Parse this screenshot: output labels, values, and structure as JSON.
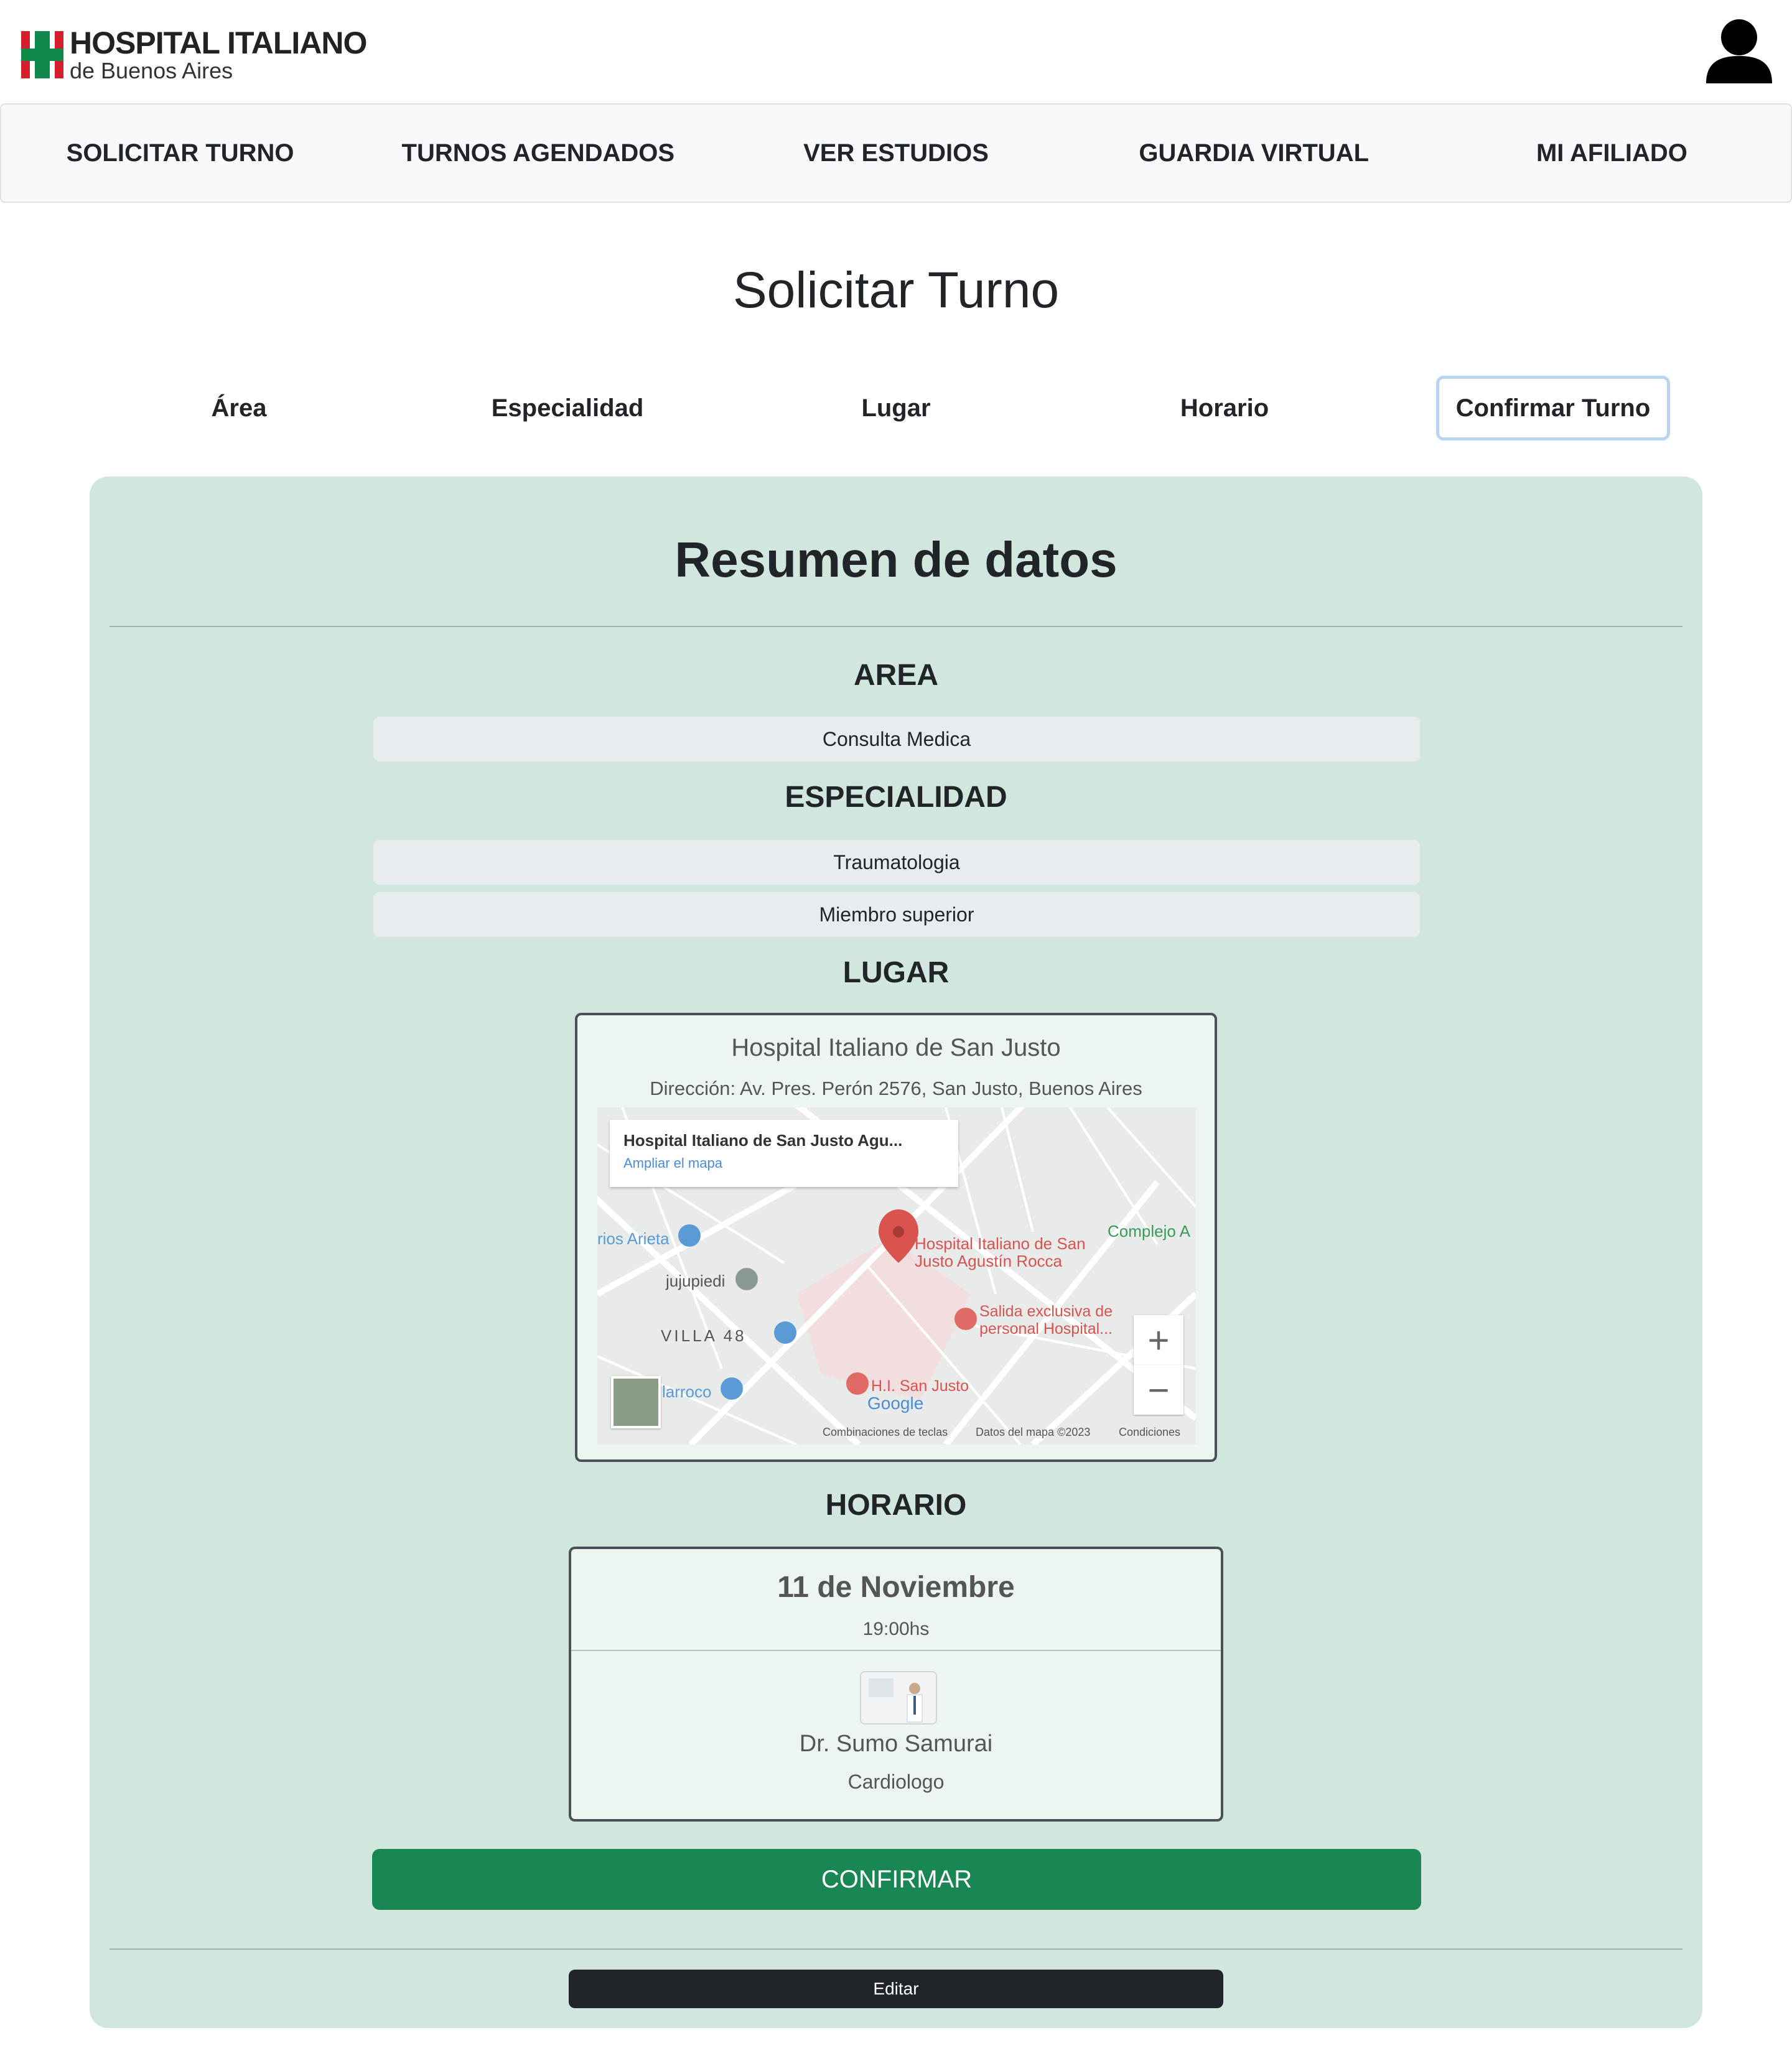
{
  "header": {
    "logo_line1": "HOSPITAL ITALIANO",
    "logo_line2": "de Buenos Aires",
    "user_icon": "user-icon"
  },
  "nav": {
    "items": [
      {
        "label": "SOLICITAR TURNO"
      },
      {
        "label": "TURNOS AGENDADOS"
      },
      {
        "label": "VER ESTUDIOS"
      },
      {
        "label": "GUARDIA VIRTUAL"
      },
      {
        "label": "MI AFILIADO"
      }
    ]
  },
  "page": {
    "title": "Solicitar Turno"
  },
  "steps": [
    {
      "label": "Área"
    },
    {
      "label": "Especialidad"
    },
    {
      "label": "Lugar"
    },
    {
      "label": "Horario"
    },
    {
      "label": "Confirmar Turno"
    }
  ],
  "summary": {
    "title": "Resumen de datos",
    "area_heading": "AREA",
    "area_value": "Consulta Medica",
    "especialidad_heading": "ESPECIALIDAD",
    "especialidad_value": "Traumatologia",
    "subespecialidad_value": "Miembro superior",
    "lugar_heading": "LUGAR",
    "lugar": {
      "name": "Hospital Italiano de San Justo",
      "address": "Dirección: Av. Pres. Perón 2576, San Justo, Buenos Aires",
      "map": {
        "info_title": "Hospital Italiano de San Justo Agu...",
        "info_link": "Ampliar el mapa",
        "pin_label_1": "Hospital Italiano de San",
        "pin_label_2": "Justo Agustín Rocca",
        "poi_1_line1": "Salida exclusiva de",
        "poi_1_line2": "personal Hospital...",
        "poi_2": "H.I. San Justo",
        "label_arieta": "rios Arieta",
        "label_jujupiedi": "jujupiedi",
        "label_villa": "VILLA 48",
        "label_larroco": "larroco",
        "label_complejo": "Complejo A",
        "google": "Google",
        "footer_1": "Combinaciones de teclas",
        "footer_2": "Datos del mapa ©2023",
        "footer_3": "Condiciones",
        "zoom_in": "+",
        "zoom_out": "−"
      }
    },
    "horario_heading": "HORARIO",
    "horario": {
      "date": "11 de Noviembre",
      "time": "19:00hs",
      "doctor": "Dr. Sumo Samurai",
      "specialty": "Cardiologo"
    },
    "confirm_label": "CONFIRMAR",
    "edit_label": "Editar"
  },
  "colors": {
    "panel_bg": "#d1e7dd",
    "confirm_green": "#198754",
    "edit_dark": "#212529",
    "step_active_border": "#b9d4ef",
    "logo_green": "#0f8a4a",
    "logo_red": "#d21f2b"
  }
}
